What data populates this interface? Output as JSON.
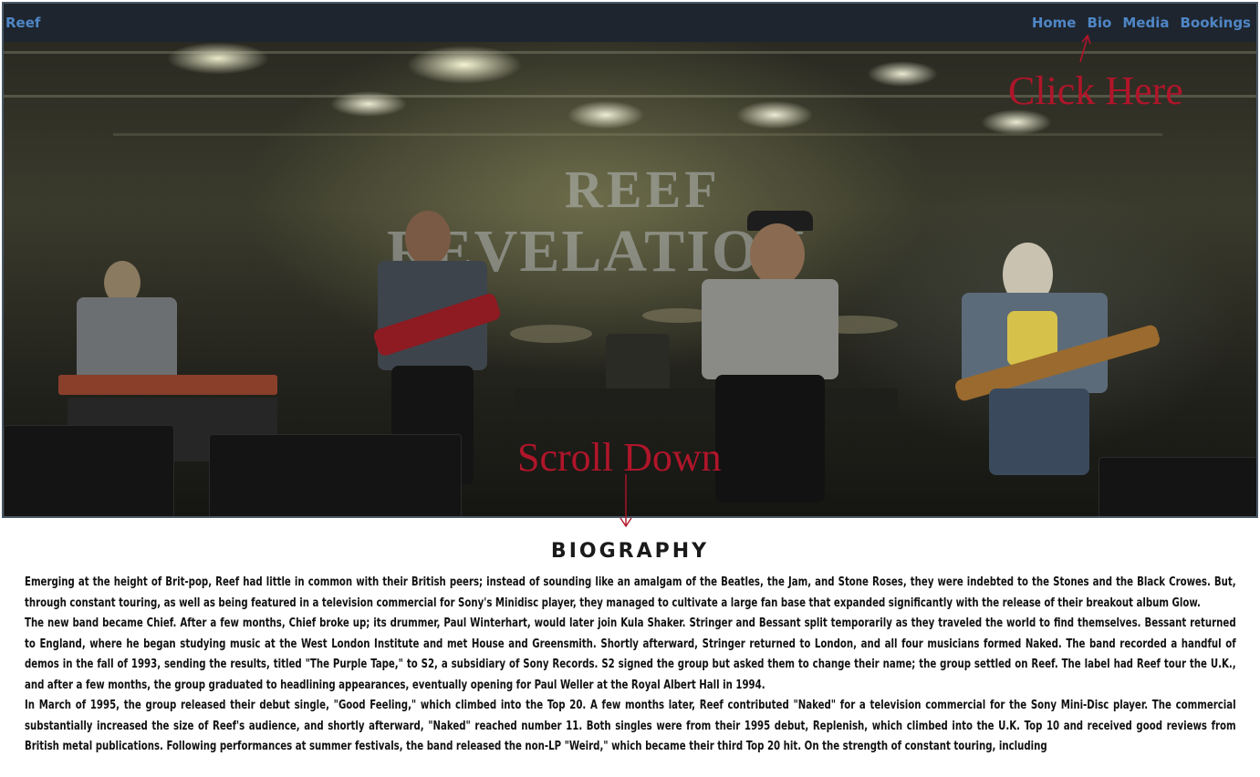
{
  "navbar": {
    "brand": "Reef",
    "links": [
      {
        "label": "Home"
      },
      {
        "label": "Bio"
      },
      {
        "label": "Media"
      },
      {
        "label": "Bookings"
      }
    ]
  },
  "hero": {
    "banner_line1": "REEF",
    "banner_line2": "REVELATION",
    "annotations": {
      "click_here": "Click Here",
      "scroll_down": "Scroll Down"
    },
    "colors": {
      "annotation": "#b0152a",
      "nav_link": "#4f86c6",
      "nav_bg": "#1e252e"
    }
  },
  "biography": {
    "title": "BIOGRAPHY",
    "paragraphs": [
      "Emerging at the height of Brit-pop, Reef had little in common with their British peers; instead of sounding like an amalgam of the Beatles, the Jam, and Stone Roses, they were indebted to the Stones and the Black Crowes. But, through constant touring, as well as being featured in a television commercial for Sony's Minidisc player, they managed to cultivate a large fan base that expanded significantly with the release of their breakout album Glow.",
      "The new band became Chief. After a few months, Chief broke up; its drummer, Paul Winterhart, would later join Kula Shaker. Stringer and Bessant split temporarily as they traveled the world to find themselves. Bessant returned to England, where he began studying music at the West London Institute and met House and Greensmith. Shortly afterward, Stringer returned to London, and all four musicians formed Naked. The band recorded a handful of demos in the fall of 1993, sending the results, titled \"The Purple Tape,\" to S2, a subsidiary of Sony Records. S2 signed the group but asked them to change their name; the group settled on Reef. The label had Reef tour the U.K., and after a few months, the group graduated to headlining appearances, eventually opening for Paul Weller at the Royal Albert Hall in 1994.",
      "In March of 1995, the group released their debut single, \"Good Feeling,\" which climbed into the Top 20. A few months later, Reef contributed \"Naked\" for a television commercial for the Sony Mini-Disc player. The commercial substantially increased the size of Reef's audience, and shortly afterward, \"Naked\" reached number 11. Both singles were from their 1995 debut, Replenish, which climbed into the U.K. Top 10 and received good reviews from British metal publications. Following performances at summer festivals, the band released the non-LP \"Weird,\" which became their third Top 20 hit. On the strength of constant touring, including"
    ]
  }
}
